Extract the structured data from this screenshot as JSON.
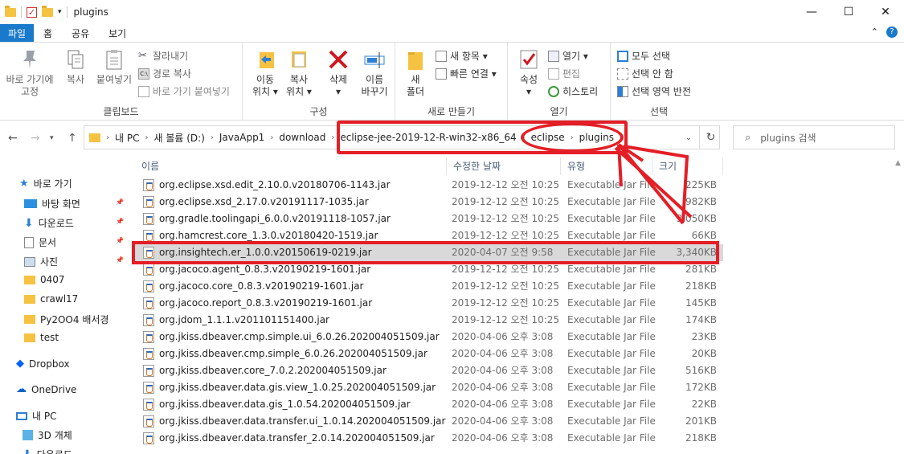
{
  "window": {
    "title": "plugins"
  },
  "titlebar": {
    "minimize": "—",
    "maximize": "☐",
    "close": "✕"
  },
  "tabs": [
    "파일",
    "홈",
    "공유",
    "보기"
  ],
  "ribbon": {
    "clipboard": {
      "label": "클립보드",
      "pin_quick": "바로 가기에\n고정",
      "copy": "복사",
      "paste": "붙여넣기",
      "cut": "잘라내기",
      "copy_path": "경로 복사",
      "paste_shortcut": "바로 가기 붙여넣기"
    },
    "organize": {
      "label": "구성",
      "move_to": "이동\n위치 ▾",
      "copy_to": "복사\n위치 ▾",
      "delete": "삭제\n▾",
      "rename": "이름\n바꾸기"
    },
    "new": {
      "label": "새로 만들기",
      "new_folder": "새\n폴더",
      "new_item": "새 항목 ▾",
      "easy_access": "빠른 연결 ▾"
    },
    "open": {
      "label": "열기",
      "properties": "속성\n▾",
      "open": "열기 ▾",
      "edit": "편집",
      "history": "히스토리"
    },
    "select": {
      "label": "선택",
      "select_all": "모두 선택",
      "select_none": "선택 안 함",
      "invert": "선택 영역 반전"
    }
  },
  "address": {
    "crumbs": [
      "내 PC",
      "새 볼륨 (D:)",
      "JavaApp1",
      "download",
      "eclipse-jee-2019-12-R-win32-x86_64",
      "eclipse",
      "plugins"
    ],
    "search_placeholder": "plugins 검색"
  },
  "nav": {
    "items": [
      {
        "label": "바로 가기",
        "icon": "star-icon"
      },
      {
        "label": "바탕 화면",
        "icon": "desktop-icon",
        "pinned": true
      },
      {
        "label": "다운로드",
        "icon": "download-icon",
        "pinned": true
      },
      {
        "label": "문서",
        "icon": "document-icon",
        "pinned": true
      },
      {
        "label": "사진",
        "icon": "picture-icon",
        "pinned": true
      },
      {
        "label": "0407",
        "icon": "folder-icon"
      },
      {
        "label": "crawl17",
        "icon": "folder-icon"
      },
      {
        "label": "Py2OO4 배서경",
        "icon": "folder-icon"
      },
      {
        "label": "test",
        "icon": "folder-icon"
      },
      {
        "label": "Dropbox",
        "icon": "dropbox-icon"
      },
      {
        "label": "OneDrive",
        "icon": "cloud-icon"
      },
      {
        "label": "내 PC",
        "icon": "pc-icon"
      },
      {
        "label": "3D 개체",
        "icon": "cube-icon"
      },
      {
        "label": "다운로드",
        "icon": "download-icon"
      }
    ]
  },
  "columns": {
    "name": "이름",
    "date": "수정한 날짜",
    "type": "유형",
    "size": "크기"
  },
  "files": [
    {
      "name": "org.eclipse.xsd.edit_2.10.0.v20180706-1143.jar",
      "date": "2019-12-12 오전 10:25",
      "type": "Executable Jar File",
      "size": "225KB"
    },
    {
      "name": "org.eclipse.xsd_2.17.0.v20191117-1035.jar",
      "date": "2019-12-12 오전 10:25",
      "type": "Executable Jar File",
      "size": "982KB"
    },
    {
      "name": "org.gradle.toolingapi_6.0.0.v20191118-1057.jar",
      "date": "2019-12-12 오전 10:25",
      "type": "Executable Jar File",
      "size": "3,050KB"
    },
    {
      "name": "org.hamcrest.core_1.3.0.v20180420-1519.jar",
      "date": "2019-12-12 오전 10:25",
      "type": "Executable Jar File",
      "size": "66KB"
    },
    {
      "name": "org.insightech.er_1.0.0.v20150619-0219.jar",
      "date": "2020-04-07 오전 9:58",
      "type": "Executable Jar File",
      "size": "3,340KB",
      "selected": true
    },
    {
      "name": "org.jacoco.agent_0.8.3.v20190219-1601.jar",
      "date": "2019-12-12 오전 10:25",
      "type": "Executable Jar File",
      "size": "281KB"
    },
    {
      "name": "org.jacoco.core_0.8.3.v20190219-1601.jar",
      "date": "2019-12-12 오전 10:25",
      "type": "Executable Jar File",
      "size": "218KB"
    },
    {
      "name": "org.jacoco.report_0.8.3.v20190219-1601.jar",
      "date": "2019-12-12 오전 10:25",
      "type": "Executable Jar File",
      "size": "145KB"
    },
    {
      "name": "org.jdom_1.1.1.v201101151400.jar",
      "date": "2019-12-12 오전 10:25",
      "type": "Executable Jar File",
      "size": "174KB"
    },
    {
      "name": "org.jkiss.dbeaver.cmp.simple.ui_6.0.26.202004051509.jar",
      "date": "2020-04-06 오후 3:08",
      "type": "Executable Jar File",
      "size": "23KB"
    },
    {
      "name": "org.jkiss.dbeaver.cmp.simple_6.0.26.202004051509.jar",
      "date": "2020-04-06 오후 3:08",
      "type": "Executable Jar File",
      "size": "20KB"
    },
    {
      "name": "org.jkiss.dbeaver.core_7.0.2.202004051509.jar",
      "date": "2020-04-06 오후 3:08",
      "type": "Executable Jar File",
      "size": "516KB"
    },
    {
      "name": "org.jkiss.dbeaver.data.gis.view_1.0.25.202004051509.jar",
      "date": "2020-04-06 오후 3:08",
      "type": "Executable Jar File",
      "size": "172KB"
    },
    {
      "name": "org.jkiss.dbeaver.data.gis_1.0.54.202004051509.jar",
      "date": "2020-04-06 오후 3:08",
      "type": "Executable Jar File",
      "size": "22KB"
    },
    {
      "name": "org.jkiss.dbeaver.data.transfer.ui_1.0.14.202004051509.jar",
      "date": "2020-04-06 오후 3:08",
      "type": "Executable Jar File",
      "size": "201KB"
    },
    {
      "name": "org.jkiss.dbeaver.data.transfer_2.0.14.202004051509.jar",
      "date": "2020-04-06 오후 3:08",
      "type": "Executable Jar File",
      "size": "218KB"
    }
  ],
  "colors": {
    "accent": "#1979ca",
    "annotation": "#e41e26",
    "selected_row": "#d9d9d9"
  }
}
